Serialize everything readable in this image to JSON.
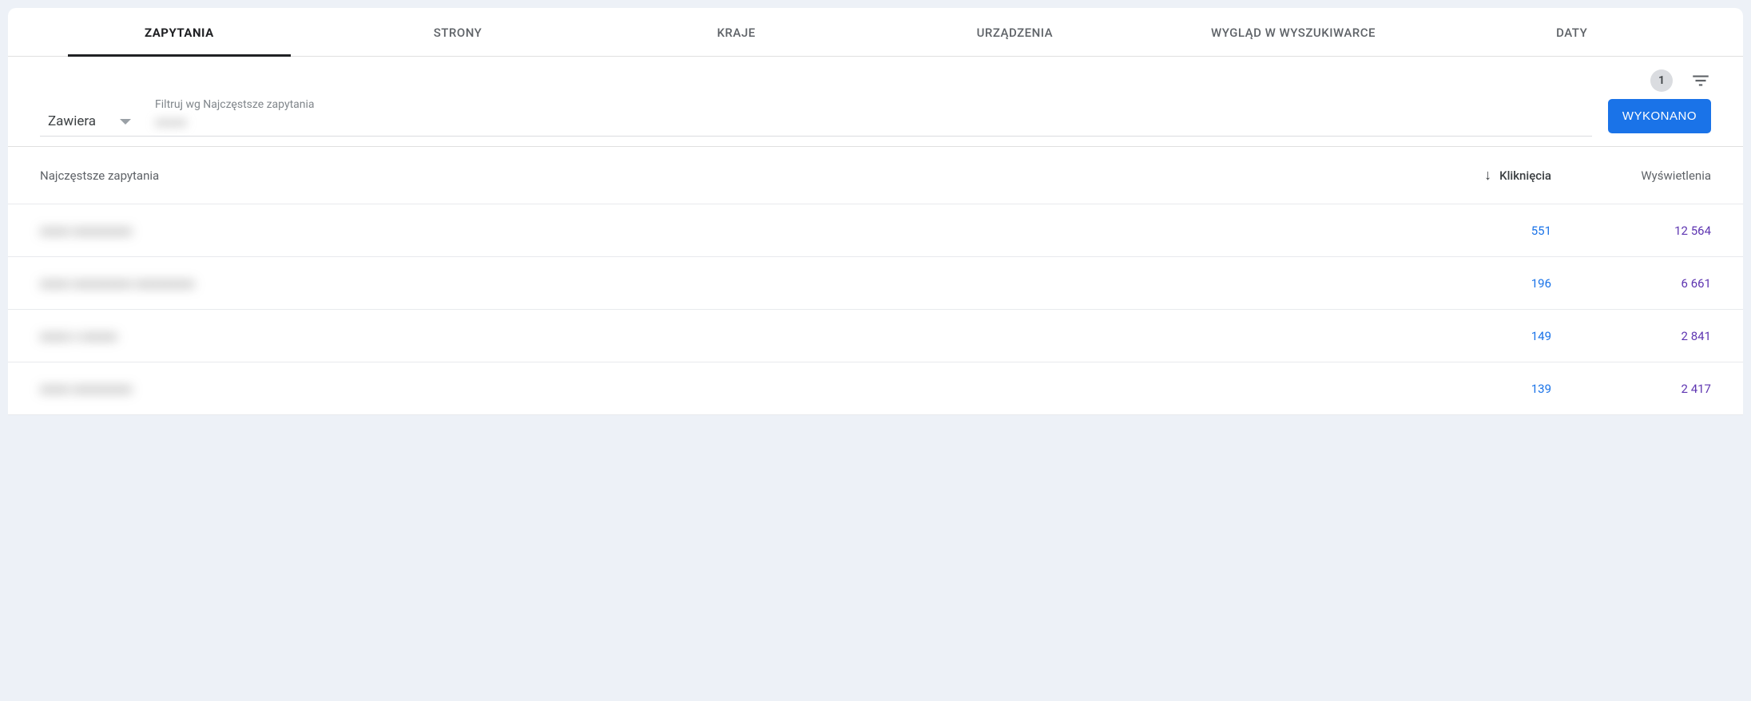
{
  "tabs": {
    "queries": "ZAPYTANIA",
    "pages": "STRONY",
    "countries": "KRAJE",
    "devices": "URZĄDZENIA",
    "appearance": "WYGLĄD W WYSZUKIWARCE",
    "dates": "DATY"
  },
  "toolbar": {
    "badge": "1"
  },
  "filter": {
    "select_value": "Zawiera",
    "input_label": "Filtruj wg Najczęstsze zapytania",
    "input_value_preview": "xxxxx",
    "done_label": "WYKONANO"
  },
  "table": {
    "head": {
      "query": "Najczęstsze zapytania",
      "clicks": "Kliknięcia",
      "impressions": "Wyświetlenia"
    },
    "rows": [
      {
        "query_preview": "xxxxx xxxxxxxxxx",
        "clicks": "551",
        "impressions": "12 564"
      },
      {
        "query_preview": "xxxxx xxxxxxxxxx xxxxxxxxxx",
        "clicks": "196",
        "impressions": "6 661"
      },
      {
        "query_preview": "xxxxx x xxxxxx",
        "clicks": "149",
        "impressions": "2 841"
      },
      {
        "query_preview": "xxxxx xxxxxxxxxx",
        "clicks": "139",
        "impressions": "2 417"
      }
    ]
  }
}
